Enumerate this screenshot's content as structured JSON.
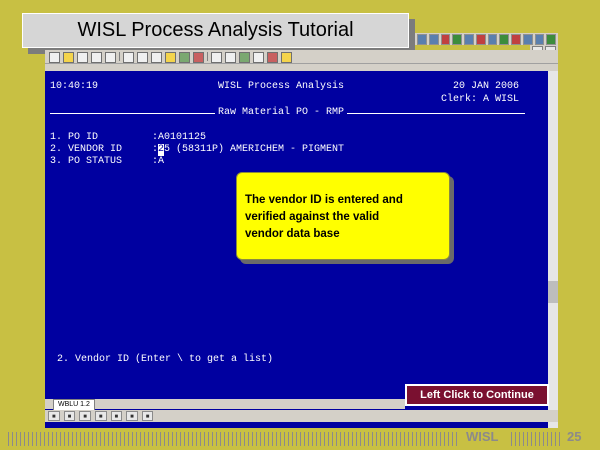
{
  "slide": {
    "title": "WISL Process Analysis Tutorial",
    "continue_label": "Left Click to Continue",
    "footer_brand": "WISL",
    "page_number": "25"
  },
  "terminal": {
    "time": "10:40:19",
    "app_title": "WISL Process Analysis",
    "date": "20 JAN 2006",
    "clerk": "Clerk: A WISL",
    "section": "Raw Material PO - RMP",
    "fields": [
      {
        "label": "1. PO ID",
        "sep": ":",
        "value": "A0101125"
      },
      {
        "label": "2. VENDOR ID",
        "sep": ":",
        "cursor_char": "2",
        "value": "5 (58311P) AMERICHEM - PIGMENT"
      },
      {
        "label": "3. PO STATUS",
        "sep": ":",
        "value": "A"
      }
    ],
    "prompt": "2. Vendor ID (Enter \\ to get a list)"
  },
  "callout": {
    "text_line1": "The vendor ID is entered and",
    "text_line2": "verified against the valid",
    "text_line3": "vendor data base"
  },
  "window_tab": "WBLU 1.2"
}
